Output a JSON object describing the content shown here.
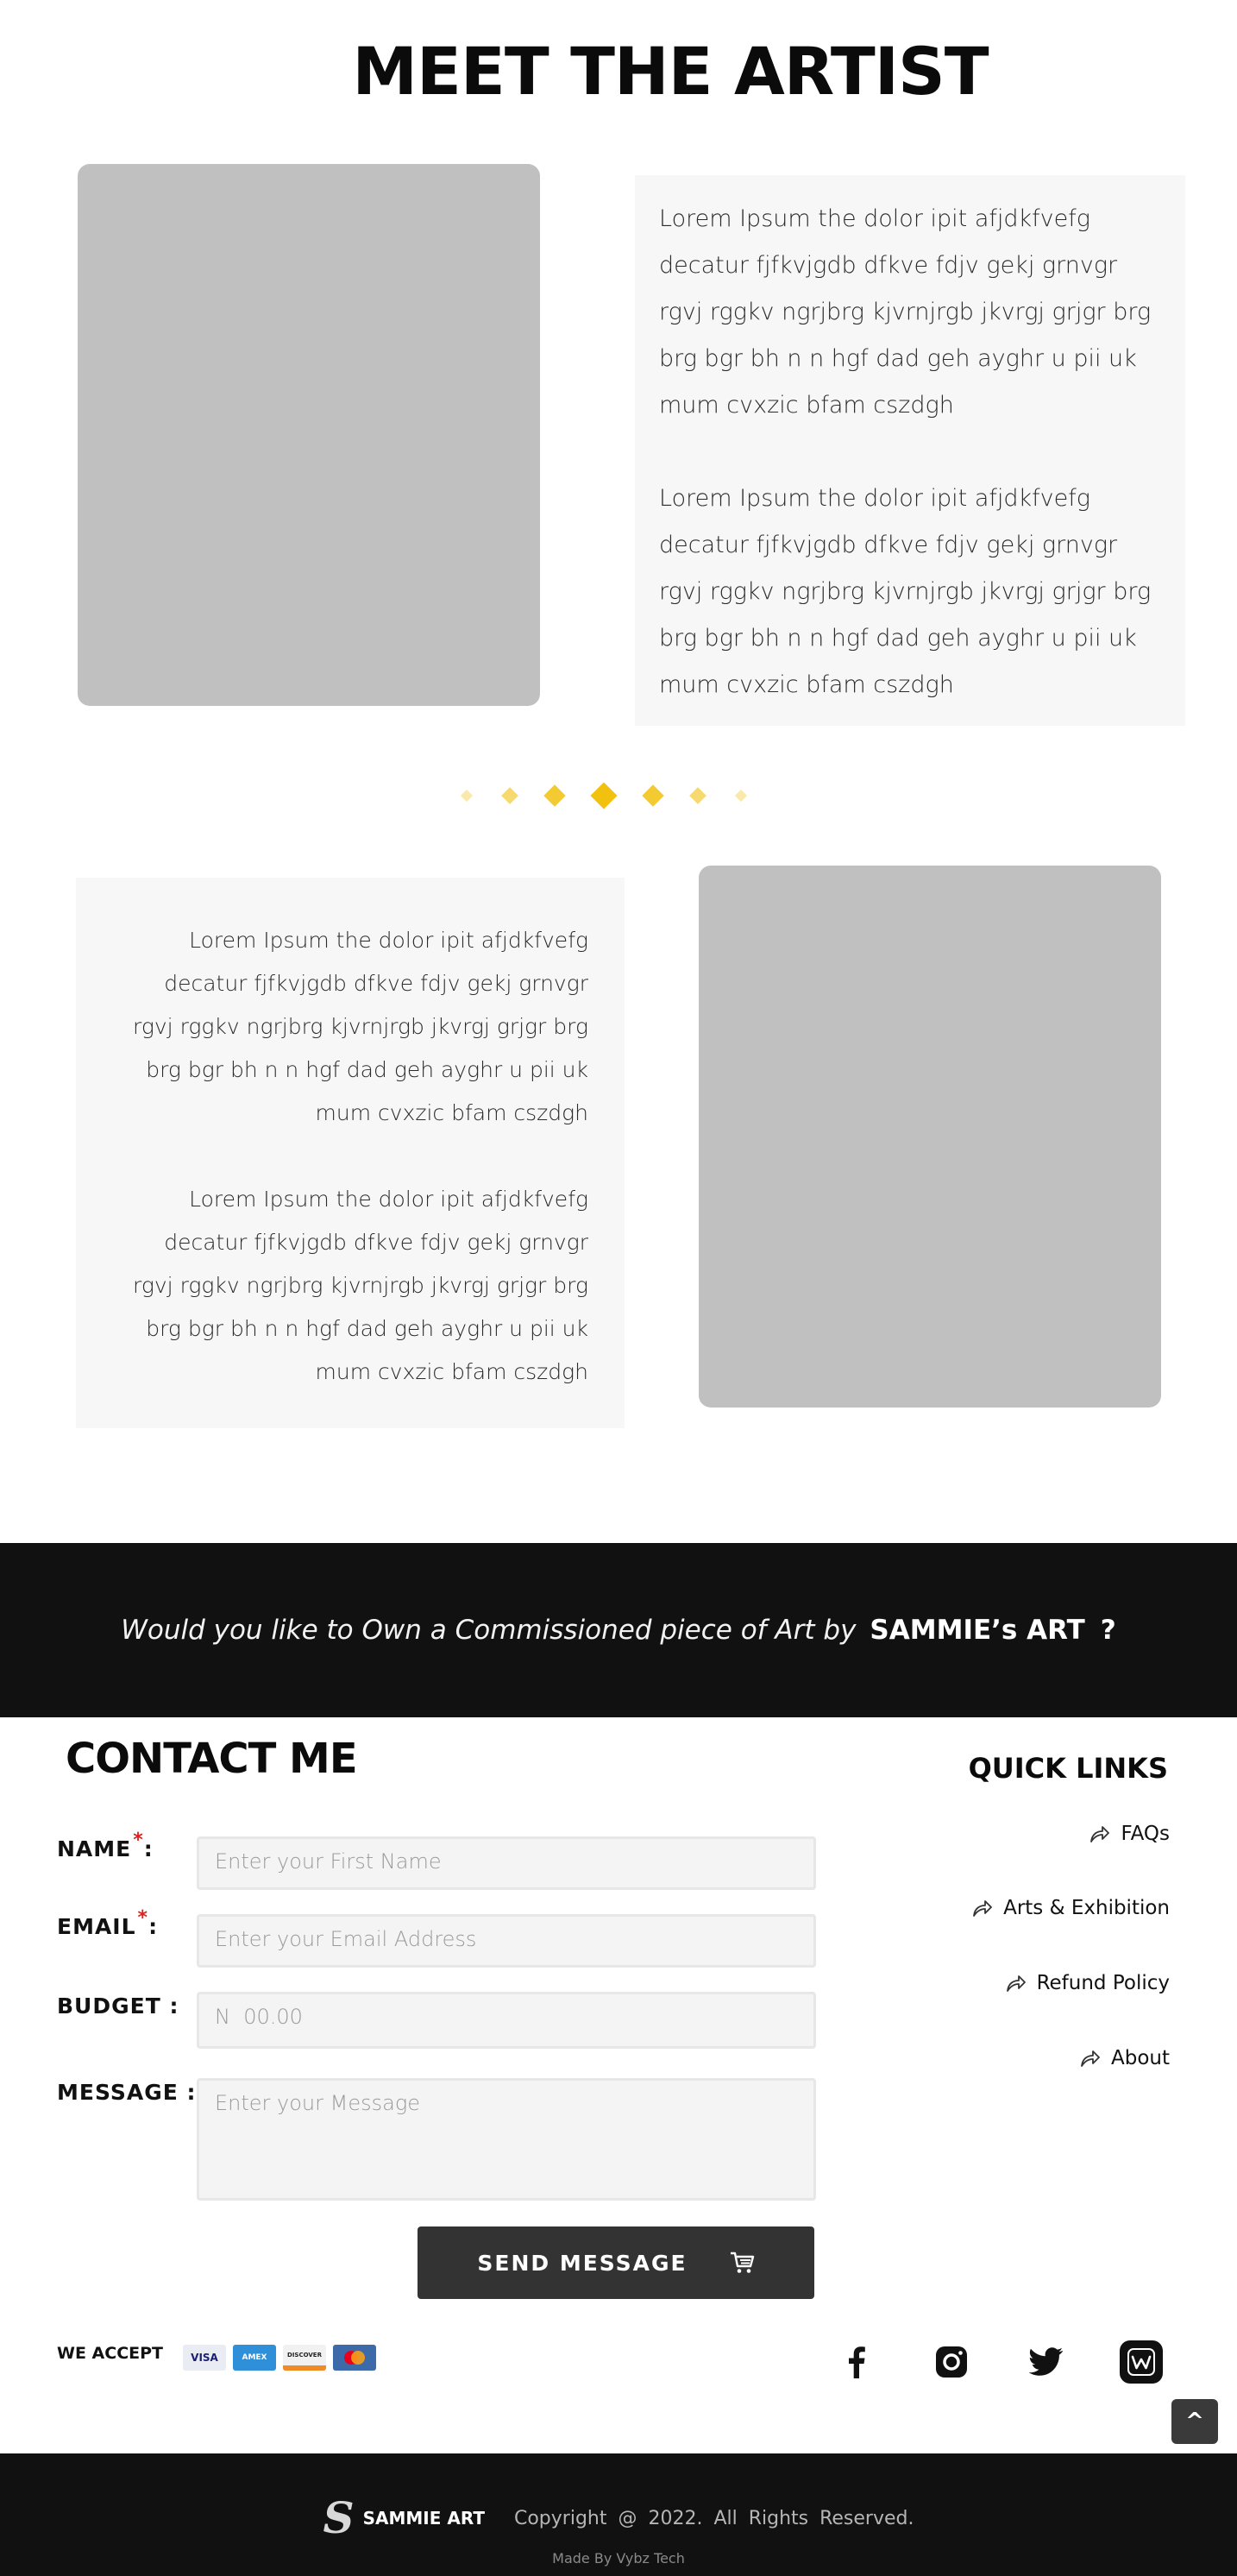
{
  "about": {
    "title": "MEET THE ARTIST",
    "block1": {
      "paragraphs": [
        "Lorem Ipsum the dolor ipit afjdkfvefg decatur fjfkvjgdb dfkve fdjv gekj grnvgr rgvj rggkv ngrjbrg kjvrnjrgb jkvrgj grjgr brg brg bgr bh n n hgf dad geh  ayghr u pii uk mum  cvxzic bfam  cszdgh",
        "Lorem Ipsum the dolor ipit afjdkfvefg decatur fjfkvjgdb dfkve fdjv gekj grnvgr rgvj rggkv ngrjbrg kjvrnjrgb jkvrgj grjgr brg brg bgr bh n n hgf dad geh  ayghr u pii uk mum  cvxzic bfam  cszdgh"
      ]
    },
    "block2": {
      "paragraphs": [
        "Lorem Ipsum the dolor ipit afjdkfvefg decatur fjfkvjgdb dfkve fdjv gekj grnvgr rgvj rggkv ngrjbrg kjvrnjrgb jkvrgj grjgr brg brg bgr bh n n hgf dad geh  ayghr u pii uk mum  cvxzic bfam  cszdgh",
        "Lorem Ipsum the dolor ipit afjdkfvefg decatur fjfkvjgdb dfkve fdjv gekj grnvgr rgvj rggkv ngrjbrg kjvrnjrgb jkvrgj grjgr brg brg bgr bh n n hgf dad geh  ayghr u pii uk mum  cvxzic bfam  cszdgh"
      ]
    },
    "divider_icon": "diamond-divider-icon",
    "accent_color": "#f2c10f"
  },
  "cta": {
    "question": "Would you like to Own a Commissioned piece of Art by",
    "brand": "SAMMIE’s ART",
    "question_mark": "?"
  },
  "contact": {
    "title": "CONTACT ME",
    "fields": {
      "name": {
        "label": "NAME",
        "placeholder": "Enter your First Name",
        "required": true
      },
      "email": {
        "label": "EMAIL",
        "placeholder": "Enter your Email Address",
        "required": true
      },
      "budget": {
        "label": "BUDGET :",
        "placeholder": "N  00.00"
      },
      "message": {
        "label": "MESSAGE :",
        "placeholder": "Enter your Message"
      }
    },
    "colon": ":",
    "required_mark": "*",
    "send_label": "SEND MESSAGE",
    "send_icon": "cart-icon"
  },
  "quick_links": {
    "title": "QUICK LINKS",
    "items": [
      {
        "label": "FAQs",
        "icon": "share-arrow-icon"
      },
      {
        "label": "Arts & Exhibition",
        "icon": "share-arrow-icon"
      },
      {
        "label": "Refund Policy",
        "icon": "share-arrow-icon"
      },
      {
        "label": "About",
        "icon": "share-arrow-icon"
      }
    ]
  },
  "payments": {
    "label": "WE ACCEPT",
    "cards": [
      "VISA",
      "AMEX",
      "DISCOVER",
      "mastercard"
    ]
  },
  "social": [
    "facebook-icon",
    "instagram-icon",
    "twitter-icon",
    "wattpad-icon"
  ],
  "back_to_top": "^",
  "footer": {
    "logo_letter": "S",
    "brand": "SAMMIE ART",
    "copyright": "Copyright @ 2022. All Rights Reserved.",
    "made_by": "Made By Vybz Tech",
    "background": "#111111"
  }
}
